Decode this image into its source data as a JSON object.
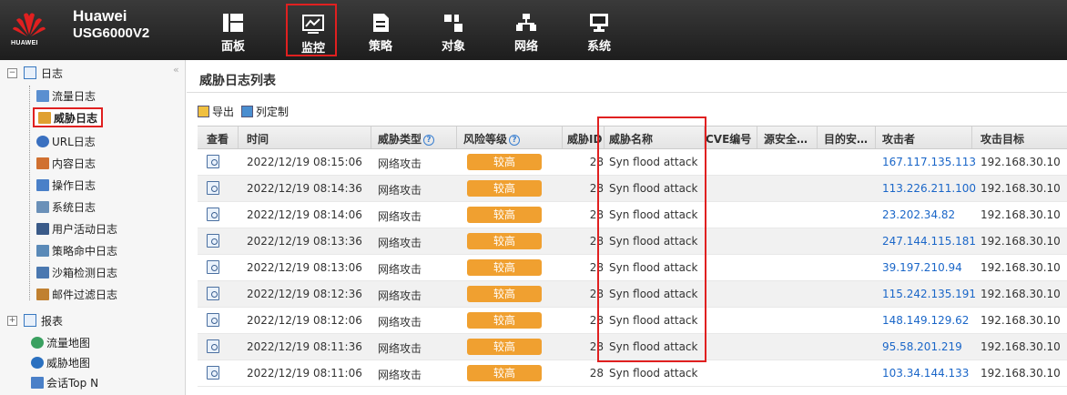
{
  "header": {
    "logo_text": "HUAWEI",
    "brand": "Huawei",
    "model": "USG6000V2",
    "nav": [
      {
        "label": "面板",
        "icon": "dashboard-icon"
      },
      {
        "label": "监控",
        "icon": "monitor-icon",
        "active": true
      },
      {
        "label": "策略",
        "icon": "policy-icon"
      },
      {
        "label": "对象",
        "icon": "object-icon"
      },
      {
        "label": "网络",
        "icon": "network-icon"
      },
      {
        "label": "系统",
        "icon": "system-icon"
      }
    ]
  },
  "sidebar": {
    "collapse": "«",
    "log_root": "日志",
    "items": [
      {
        "label": "流量日志"
      },
      {
        "label": "威胁日志",
        "selected": true
      },
      {
        "label": "URL日志"
      },
      {
        "label": "内容日志"
      },
      {
        "label": "操作日志"
      },
      {
        "label": "系统日志"
      },
      {
        "label": "用户活动日志"
      },
      {
        "label": "策略命中日志"
      },
      {
        "label": "沙箱检测日志"
      },
      {
        "label": "邮件过滤日志"
      }
    ],
    "report_root": "报表",
    "leaves": [
      {
        "label": "流量地图"
      },
      {
        "label": "威胁地图"
      },
      {
        "label": "会话Top N"
      }
    ]
  },
  "main": {
    "title": "威胁日志列表",
    "toolbar": {
      "export": "导出",
      "customize": "列定制"
    },
    "columns": [
      "查看",
      "时间",
      "威胁类型",
      "风险等级",
      "威胁ID",
      "威胁名称",
      "CVE编号",
      "源安全…",
      "目的安…",
      "攻击者",
      "攻击目标"
    ],
    "help_mark": "?",
    "rows": [
      {
        "time": "2022/12/19 08:15:06",
        "type": "网络攻击",
        "risk": "较高",
        "id": "28",
        "name": "Syn flood attack",
        "attacker": "167.117.135.113",
        "target": "192.168.30.10"
      },
      {
        "time": "2022/12/19 08:14:36",
        "type": "网络攻击",
        "risk": "较高",
        "id": "28",
        "name": "Syn flood attack",
        "attacker": "113.226.211.100",
        "target": "192.168.30.10"
      },
      {
        "time": "2022/12/19 08:14:06",
        "type": "网络攻击",
        "risk": "较高",
        "id": "28",
        "name": "Syn flood attack",
        "attacker": "23.202.34.82",
        "target": "192.168.30.10"
      },
      {
        "time": "2022/12/19 08:13:36",
        "type": "网络攻击",
        "risk": "较高",
        "id": "28",
        "name": "Syn flood attack",
        "attacker": "247.144.115.181",
        "target": "192.168.30.10"
      },
      {
        "time": "2022/12/19 08:13:06",
        "type": "网络攻击",
        "risk": "较高",
        "id": "28",
        "name": "Syn flood attack",
        "attacker": "39.197.210.94",
        "target": "192.168.30.10"
      },
      {
        "time": "2022/12/19 08:12:36",
        "type": "网络攻击",
        "risk": "较高",
        "id": "28",
        "name": "Syn flood attack",
        "attacker": "115.242.135.191",
        "target": "192.168.30.10"
      },
      {
        "time": "2022/12/19 08:12:06",
        "type": "网络攻击",
        "risk": "较高",
        "id": "28",
        "name": "Syn flood attack",
        "attacker": "148.149.129.62",
        "target": "192.168.30.10"
      },
      {
        "time": "2022/12/19 08:11:36",
        "type": "网络攻击",
        "risk": "较高",
        "id": "28",
        "name": "Syn flood attack",
        "attacker": "95.58.201.219",
        "target": "192.168.30.10"
      },
      {
        "time": "2022/12/19 08:11:06",
        "type": "网络攻击",
        "risk": "较高",
        "id": "28",
        "name": "Syn flood attack",
        "attacker": "103.34.144.133",
        "target": "192.168.30.10"
      }
    ]
  },
  "colors": {
    "accent_red": "#e02020",
    "risk_orange": "#f0a030",
    "link_blue": "#1a66c8"
  }
}
